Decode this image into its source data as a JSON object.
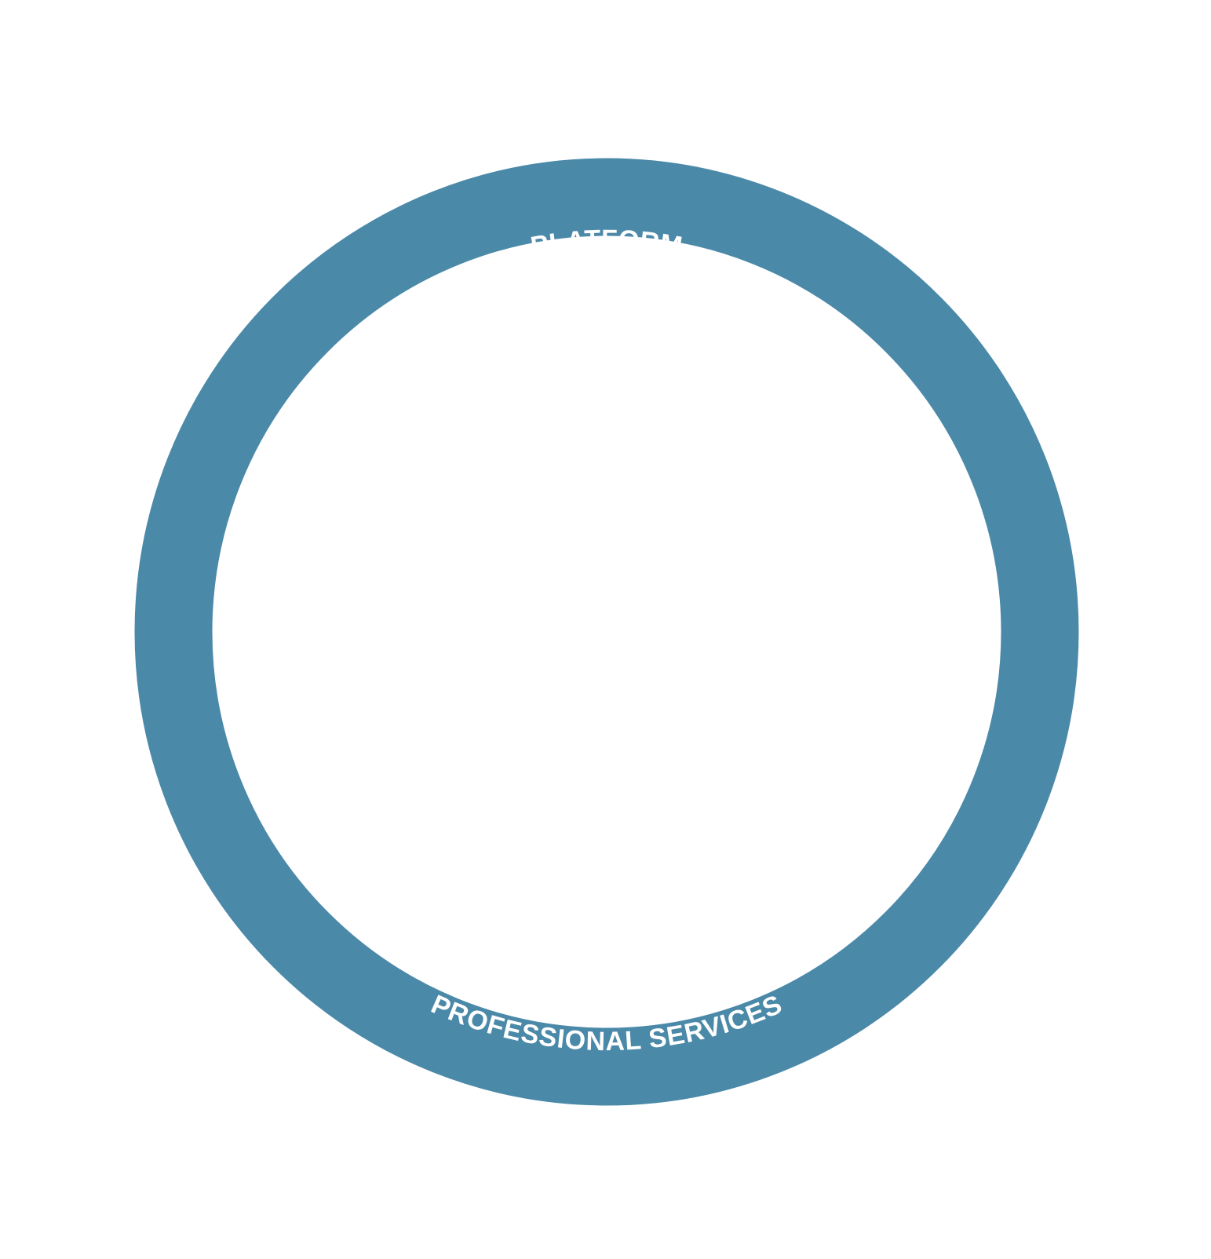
{
  "diagram": {
    "ring_color": "#4b89a9",
    "label_color": "#ffffff",
    "top_label": "PLATFORM",
    "bottom_label": "PROFESSIONAL SERVICES"
  }
}
